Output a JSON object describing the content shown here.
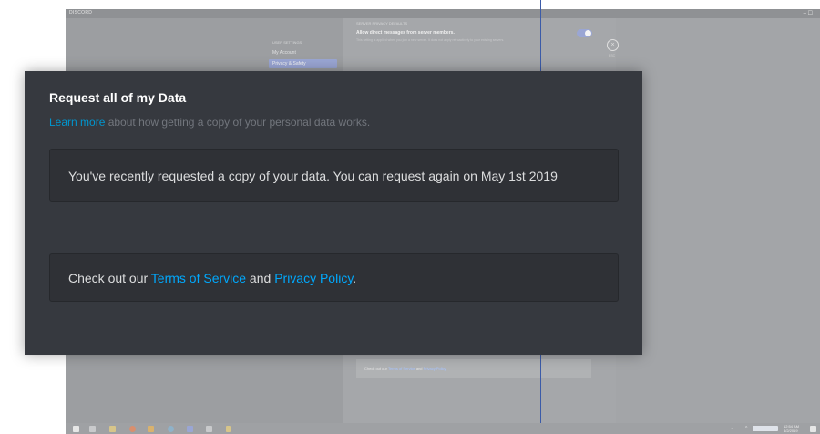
{
  "background": {
    "window_title": "DISCORD",
    "window_controls": "–  ☐",
    "sidebar": {
      "section_label": "USER SETTINGS",
      "items": [
        {
          "label": "My Account"
        },
        {
          "label": "Privacy & Safety",
          "active": true
        }
      ]
    },
    "privacy": {
      "section_heading": "SERVER PRIVACY DEFAULTS",
      "allow_dm_label": "Allow direct messages from server members.",
      "allow_dm_description": "This setting is applied when you join a new server. It does not apply retroactively to your existing servers.",
      "allow_dm_enabled": true,
      "close_label": "×",
      "esc_label": "ESC"
    },
    "footer": {
      "prefix": "Check out our ",
      "tos_link": "Terms of Service",
      "middle": " and ",
      "privacy_link": "Privacy Policy",
      "suffix": "."
    }
  },
  "taskbar": {
    "clock_time": "12:54 AM",
    "clock_date": "4/2/2019"
  },
  "modal": {
    "title": "Request all of my Data",
    "learn_more_link": "Learn more",
    "learn_more_rest": " about how getting a copy of your personal data works.",
    "status_message": "You've recently requested a copy of your data. You can request again on May 1st 2019",
    "footer_prefix": "Check out our ",
    "tos_link": "Terms of Service",
    "footer_middle": " and ",
    "privacy_link": "Privacy Policy",
    "footer_suffix": ".",
    "colors": {
      "background": "#36393f",
      "card": "#2f3136",
      "link": "#00a8fc",
      "muted_text": "#72767d"
    }
  }
}
